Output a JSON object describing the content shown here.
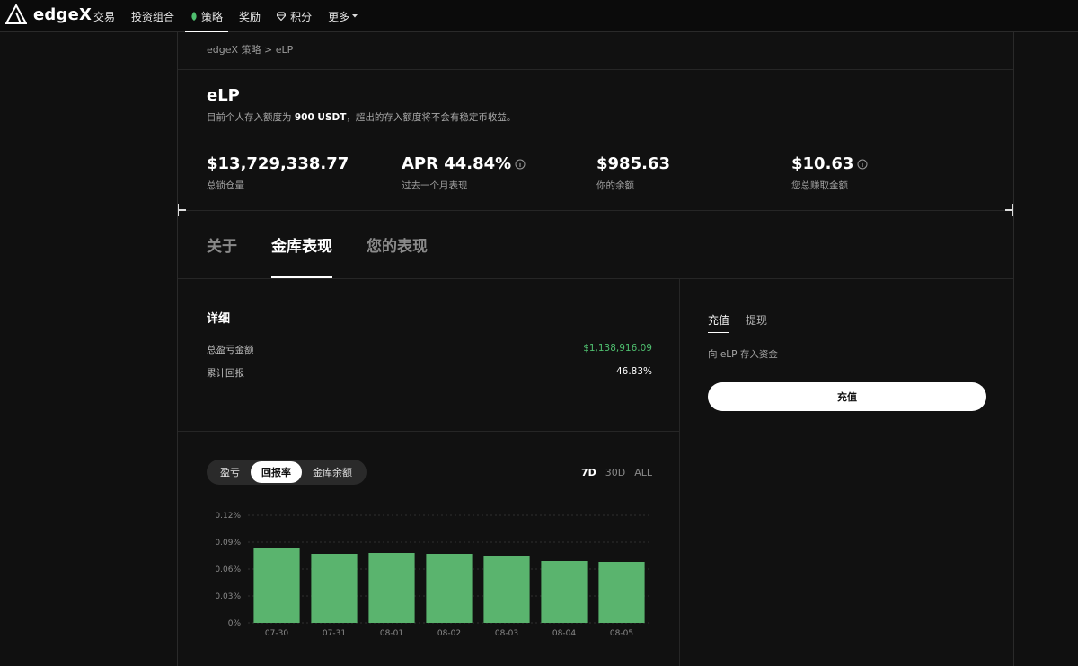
{
  "nav": {
    "brand": "edgeX",
    "items": [
      {
        "label": "交易",
        "icon": null
      },
      {
        "label": "投资组合",
        "icon": null
      },
      {
        "label": "策略",
        "icon": "leaf-icon"
      },
      {
        "label": "奖励",
        "icon": null
      },
      {
        "label": "积分",
        "icon": "diamond-icon"
      },
      {
        "label": "更多",
        "icon": "chevron-down-icon"
      }
    ],
    "active_index": 2
  },
  "breadcrumb": "edgeX 策略 > eLP",
  "page": {
    "title": "eLP",
    "subtitle_pre": "目前个人存入额度为 ",
    "subtitle_limit": "900 USDT",
    "subtitle_post": "，超出的存入额度将不会有稳定币收益。"
  },
  "stats": [
    {
      "value": "$13,729,338.77",
      "label": "总锁仓量",
      "info": false
    },
    {
      "value": "APR 44.84%",
      "label": "过去一个月表现",
      "info": true
    },
    {
      "value": "$985.63",
      "label": "你的余额",
      "info": false
    },
    {
      "value": "$10.63",
      "label": "您总赚取金额",
      "info": true
    }
  ],
  "tabs": [
    "关于",
    "金库表现",
    "您的表现"
  ],
  "active_tab": 1,
  "details": {
    "title": "详细",
    "rows": [
      {
        "label": "总盈亏金额",
        "value": "$1,138,916.09",
        "color": "#4fbf6f"
      },
      {
        "label": "累计回报",
        "value": "46.83%",
        "color": "#ffffff"
      }
    ]
  },
  "chart_controls": {
    "metrics": [
      "盈亏",
      "回报率",
      "金库余额"
    ],
    "active_metric": 1,
    "ranges": [
      "7D",
      "30D",
      "ALL"
    ],
    "active_range": 0
  },
  "chart_data": {
    "type": "bar",
    "categories": [
      "07-30",
      "07-31",
      "08-01",
      "08-02",
      "08-03",
      "08-04",
      "08-05"
    ],
    "values": [
      0.083,
      0.077,
      0.078,
      0.077,
      0.074,
      0.069,
      0.068
    ],
    "y_ticks": [
      "0%",
      "0.03%",
      "0.06%",
      "0.09%",
      "0.12%"
    ],
    "ylim": [
      0,
      0.12
    ],
    "unit": "%",
    "bar_color": "#5ab46e",
    "grid": true
  },
  "actions": {
    "tabs": [
      "充值",
      "提现"
    ],
    "active": 0,
    "description": "向 eLP 存入资金",
    "button_label": "充值"
  }
}
